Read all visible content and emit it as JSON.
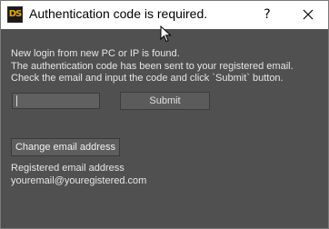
{
  "window": {
    "app_icon_text": "DS",
    "title": "Authentication code is required.",
    "help_label": "?",
    "close_label": "close"
  },
  "message": {
    "line1": "New login from new PC or IP is found.",
    "line2": "The authentication code has been sent to your registered email.",
    "line3": " Check the email and input the code and click `Submit` button."
  },
  "code_input": {
    "value": "",
    "placeholder": ""
  },
  "submit_label": "Submit",
  "change_email_label": "Change email address",
  "registered": {
    "label": "Registered email address",
    "email": "youremail@youregistered.com"
  },
  "colors": {
    "window_bg": "#505050",
    "titlebar_bg": "#ffffff",
    "text": "#e6e6e6",
    "icon_accent": "#f0a800"
  },
  "icons": {
    "app": "ds-app-icon",
    "close": "close-icon",
    "cursor": "mouse-pointer-icon"
  }
}
